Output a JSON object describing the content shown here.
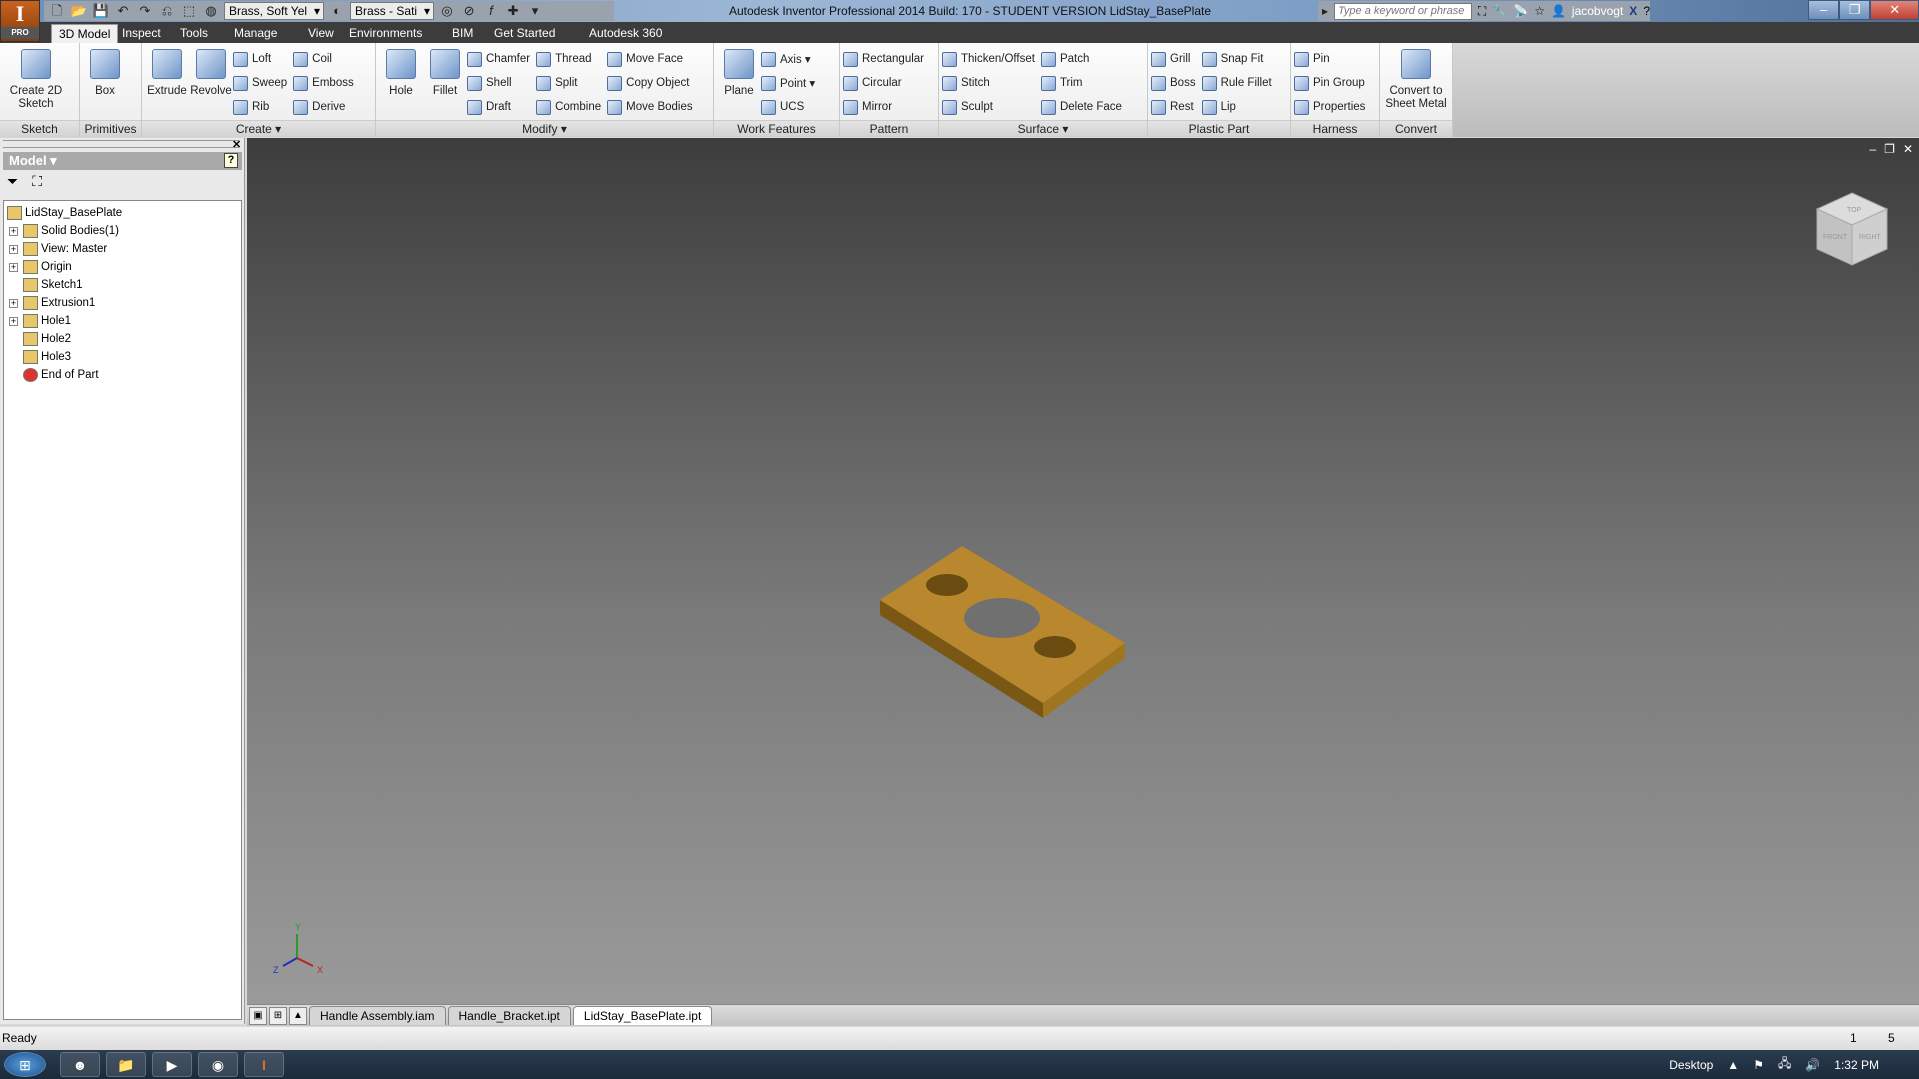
{
  "app": {
    "logo_text": "I",
    "logo_badge": "PRO",
    "title": "Autodesk Inventor Professional 2014 Build: 170 - STUDENT VERSION   LidStay_BasePlate"
  },
  "qat": {
    "material": "Brass, Soft Yel",
    "appearance": "Brass - Sati"
  },
  "help": {
    "search_placeholder": "Type a keyword or phrase",
    "user": "jacobvogt"
  },
  "tabs": [
    "3D Model",
    "Inspect",
    "Tools",
    "Manage",
    "View",
    "Environments",
    "BIM",
    "Get Started",
    "Autodesk 360"
  ],
  "ribbon": [
    {
      "label": "Sketch",
      "w": 80,
      "large": [
        "Create 2D Sketch"
      ],
      "cols": []
    },
    {
      "label": "Primitives",
      "w": 62,
      "large": [
        "Box"
      ],
      "cols": []
    },
    {
      "label": "Create ▾",
      "w": 234,
      "large": [
        "Extrude",
        "Revolve"
      ],
      "cols": [
        [
          "Loft",
          "Sweep",
          "Rib"
        ],
        [
          "Coil",
          "Emboss",
          "Derive"
        ]
      ]
    },
    {
      "label": "Modify ▾",
      "w": 338,
      "large": [
        "Hole",
        "Fillet"
      ],
      "cols": [
        [
          "Chamfer",
          "Shell",
          "Draft"
        ],
        [
          "Thread",
          "Split",
          "Combine"
        ],
        [
          "Move Face",
          "Copy Object",
          "Move Bodies"
        ]
      ]
    },
    {
      "label": "Work Features",
      "w": 126,
      "large": [
        "Plane"
      ],
      "cols": [
        [
          "Axis ▾",
          "Point ▾",
          "UCS"
        ]
      ]
    },
    {
      "label": "Pattern",
      "w": 99,
      "large": [],
      "cols": [
        [
          "Rectangular",
          "Circular",
          "Mirror"
        ]
      ]
    },
    {
      "label": "Surface ▾",
      "w": 209,
      "large": [],
      "cols": [
        [
          "Thicken/Offset",
          "Stitch",
          "Sculpt"
        ],
        [
          "Patch",
          "Trim",
          "Delete Face"
        ]
      ]
    },
    {
      "label": "Plastic Part",
      "w": 143,
      "large": [],
      "cols": [
        [
          "Grill",
          "Boss",
          "Rest"
        ],
        [
          "Snap Fit",
          "Rule Fillet",
          "Lip"
        ]
      ]
    },
    {
      "label": "Harness",
      "w": 89,
      "large": [],
      "cols": [
        [
          "Pin",
          "Pin Group",
          "Properties"
        ]
      ]
    },
    {
      "label": "Convert",
      "w": 73,
      "large": [
        "Convert to Sheet Metal"
      ],
      "cols": []
    }
  ],
  "browser": {
    "title": "Model ▾",
    "help": "?",
    "tree": [
      {
        "label": "LidStay_BasePlate",
        "root": true
      },
      {
        "label": "Solid Bodies(1)",
        "exp": true
      },
      {
        "label": "View: Master",
        "exp": true
      },
      {
        "label": "Origin",
        "exp": true
      },
      {
        "label": "Sketch1",
        "exp": false
      },
      {
        "label": "Extrusion1",
        "exp": true
      },
      {
        "label": "Hole1",
        "exp": true
      },
      {
        "label": "Hole2",
        "exp": false
      },
      {
        "label": "Hole3",
        "exp": false
      },
      {
        "label": "End of Part",
        "exp": false,
        "end": true
      }
    ]
  },
  "viewcube": {
    "top": "TOP",
    "front": "FRONT",
    "right": "RIGHT"
  },
  "triad": {
    "x": "X",
    "y": "Y",
    "z": "Z"
  },
  "doc_tabs": [
    {
      "label": "Handle Assembly.iam"
    },
    {
      "label": "Handle_Bracket.ipt"
    },
    {
      "label": "LidStay_BasePlate.ipt",
      "active": true
    }
  ],
  "status": {
    "text": "Ready",
    "count1": "1",
    "count2": "5"
  },
  "taskbar": {
    "desktop": "Desktop",
    "time": "1:32 PM"
  },
  "colors": {
    "part": "#b8872e",
    "ribbon_tab_bg": "#3c3c3c"
  }
}
